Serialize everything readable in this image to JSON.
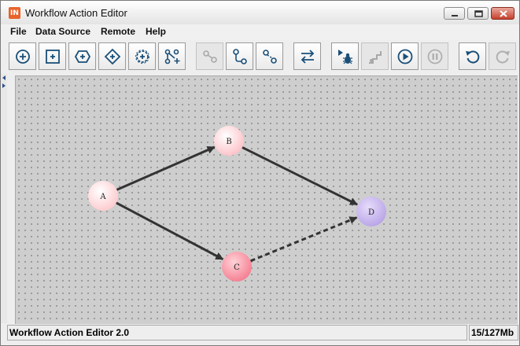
{
  "window": {
    "title": "Workflow Action Editor",
    "app_icon_text": "IN"
  },
  "menu": [
    "File",
    "Data Source",
    "Remote",
    "Help"
  ],
  "toolbar": [
    {
      "icon": "add-circle-node-icon",
      "enabled": true
    },
    {
      "icon": "add-square-node-icon",
      "enabled": true
    },
    {
      "icon": "add-hexagon-node-icon",
      "enabled": true
    },
    {
      "icon": "add-diamond-node-icon",
      "enabled": true
    },
    {
      "icon": "add-gear-node-icon",
      "enabled": true
    },
    {
      "icon": "add-branch-icon",
      "enabled": true
    },
    {
      "icon": "link-nodes-icon",
      "enabled": false
    },
    {
      "icon": "connect-nodes-icon",
      "enabled": true
    },
    {
      "icon": "connect-dashed-icon",
      "enabled": true
    },
    {
      "icon": "swap-direction-icon",
      "enabled": true
    },
    {
      "icon": "debug-run-icon",
      "enabled": true
    },
    {
      "icon": "step-icon",
      "enabled": false
    },
    {
      "icon": "play-icon",
      "enabled": true
    },
    {
      "icon": "pause-icon",
      "enabled": false
    },
    {
      "icon": "undo-icon",
      "enabled": true
    },
    {
      "icon": "redo-icon",
      "enabled": false
    }
  ],
  "graph": {
    "nodes": [
      {
        "id": "A",
        "label": "A",
        "fill": "#fcc8cc"
      },
      {
        "id": "B",
        "label": "B",
        "fill": "#fcc0c6"
      },
      {
        "id": "C",
        "label": "C",
        "fill": "#f47b8e"
      },
      {
        "id": "D",
        "label": "D",
        "fill": "#b7a2e6"
      }
    ],
    "edges": [
      {
        "from": "A",
        "to": "B",
        "style": "solid"
      },
      {
        "from": "A",
        "to": "C",
        "style": "solid"
      },
      {
        "from": "B",
        "to": "D",
        "style": "solid"
      },
      {
        "from": "C",
        "to": "D",
        "style": "dashed"
      }
    ]
  },
  "status": {
    "message": "Workflow Action Editor 2.0",
    "memory": "15/127Mb"
  }
}
